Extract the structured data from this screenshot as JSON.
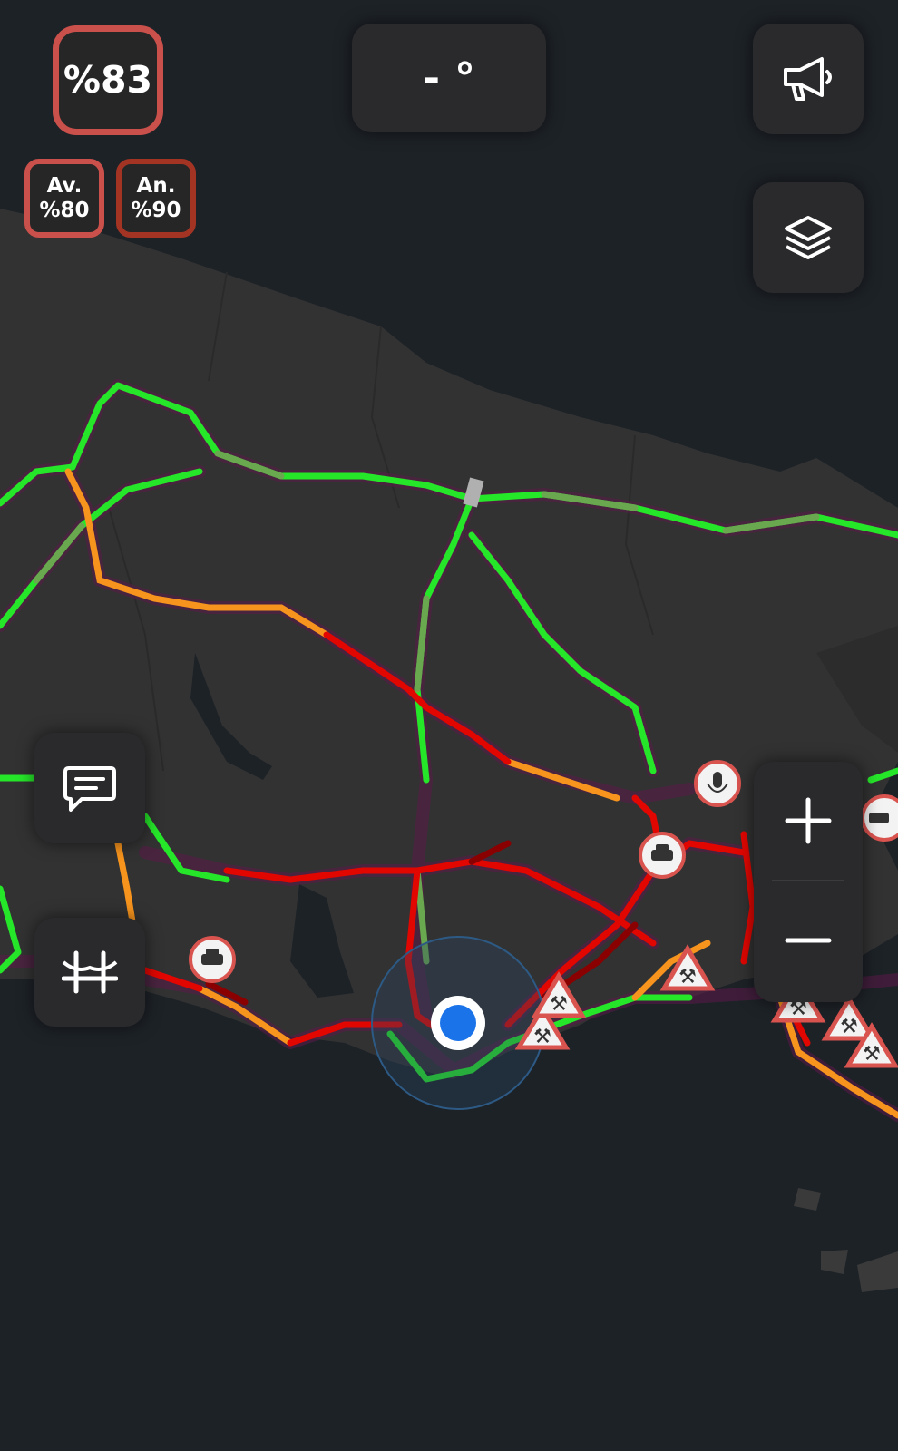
{
  "levels": {
    "overall": "%83",
    "av_label": "Av.",
    "av_value": "%80",
    "an_label": "An.",
    "an_value": "%90"
  },
  "weather": {
    "temp": "- °"
  },
  "buttons": {
    "announcements": "megaphone-icon",
    "layers": "layers-icon",
    "feedback": "message-icon",
    "bridges": "bridge-icon",
    "zoom_in": "plus-icon",
    "zoom_out": "minus-icon"
  },
  "map_markers": [
    {
      "type": "roadwork",
      "icon": "roadwork-icon"
    },
    {
      "type": "accident",
      "icon": "accident-icon"
    },
    {
      "type": "vehicle-breakdown",
      "icon": "breakdown-icon"
    },
    {
      "type": "voice-report",
      "icon": "microphone-icon"
    },
    {
      "type": "current-location",
      "icon": "location-dot-icon"
    }
  ],
  "colors": {
    "free_flow": "#26e62a",
    "moderate": "#6aa84f",
    "slow": "#f7941d",
    "heavy": "#e10600",
    "jam": "#8a0000",
    "border_overall": "#c9504b",
    "border_an": "#a33424",
    "location": "#1a73e8"
  }
}
